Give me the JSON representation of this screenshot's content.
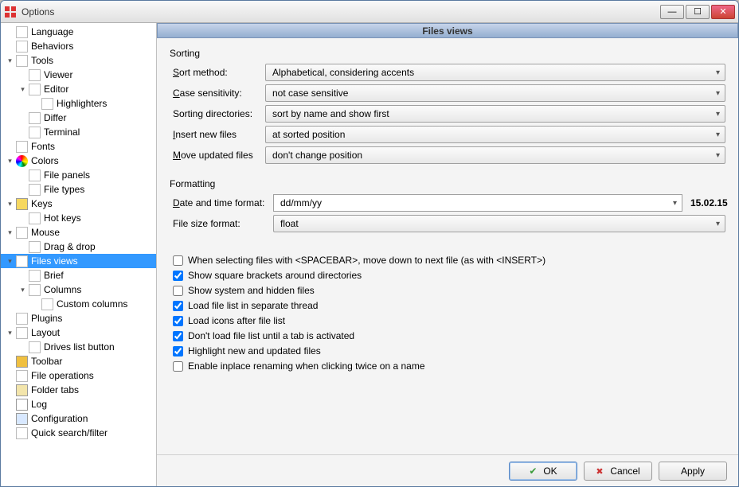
{
  "window": {
    "title": "Options"
  },
  "tree": [
    {
      "level": 0,
      "label": "Language",
      "icon": "page"
    },
    {
      "level": 0,
      "label": "Behaviors",
      "icon": "page"
    },
    {
      "level": 0,
      "label": "Tools",
      "icon": "page",
      "expander": "▾"
    },
    {
      "level": 1,
      "label": "Viewer",
      "icon": "page"
    },
    {
      "level": 1,
      "label": "Editor",
      "icon": "page",
      "expander": "▾"
    },
    {
      "level": 2,
      "label": "Highlighters",
      "icon": "page"
    },
    {
      "level": 1,
      "label": "Differ",
      "icon": "page"
    },
    {
      "level": 1,
      "label": "Terminal",
      "icon": "page"
    },
    {
      "level": 0,
      "label": "Fonts",
      "icon": "page"
    },
    {
      "level": 0,
      "label": "Colors",
      "icon": "colorball",
      "expander": "▾"
    },
    {
      "level": 1,
      "label": "File panels",
      "icon": "page"
    },
    {
      "level": 1,
      "label": "File types",
      "icon": "page"
    },
    {
      "level": 0,
      "label": "Keys",
      "icon": "key",
      "expander": "▾"
    },
    {
      "level": 1,
      "label": "Hot keys",
      "icon": "page"
    },
    {
      "level": 0,
      "label": "Mouse",
      "icon": "page",
      "expander": "▾"
    },
    {
      "level": 1,
      "label": "Drag & drop",
      "icon": "page"
    },
    {
      "level": 0,
      "label": "Files views",
      "icon": "page",
      "expander": "▾",
      "selected": true
    },
    {
      "level": 1,
      "label": "Brief",
      "icon": "page"
    },
    {
      "level": 1,
      "label": "Columns",
      "icon": "page",
      "expander": "▾"
    },
    {
      "level": 2,
      "label": "Custom columns",
      "icon": "page"
    },
    {
      "level": 0,
      "label": "Plugins",
      "icon": "page"
    },
    {
      "level": 0,
      "label": "Layout",
      "icon": "page",
      "expander": "▾"
    },
    {
      "level": 1,
      "label": "Drives list button",
      "icon": "page"
    },
    {
      "level": 0,
      "label": "Toolbar",
      "icon": "toolbar"
    },
    {
      "level": 0,
      "label": "File operations",
      "icon": "page"
    },
    {
      "level": 0,
      "label": "Folder tabs",
      "icon": "folder"
    },
    {
      "level": 0,
      "label": "Log",
      "icon": "log"
    },
    {
      "level": 0,
      "label": "Configuration",
      "icon": "config"
    },
    {
      "level": 0,
      "label": "Quick search/filter",
      "icon": "page"
    }
  ],
  "panel": {
    "title": "Files views",
    "sorting_group": "Sorting",
    "formatting_group": "Formatting",
    "labels": {
      "sort_method": "Sort method:",
      "case_sensitivity": "Case sensitivity:",
      "sorting_directories": "Sorting directories:",
      "insert_new_files": "Insert new files",
      "move_updated_files": "Move updated files",
      "date_format": "Date and time format:",
      "file_size_format": "File size format:"
    },
    "values": {
      "sort_method": "Alphabetical, considering accents",
      "case_sensitivity": "not case sensitive",
      "sorting_directories": "sort by name and show first",
      "insert_new_files": "at sorted position",
      "move_updated_files": "don't change position",
      "date_format": "dd/mm/yy",
      "date_preview": "15.02.15",
      "file_size_format": "float"
    },
    "checks": [
      {
        "label": "When selecting files with <SPACEBAR>, move down to next file (as with <INSERT>)",
        "checked": false
      },
      {
        "label": "Show square brackets around directories",
        "checked": true
      },
      {
        "label": "Show system and hidden files",
        "checked": false
      },
      {
        "label": "Load file list in separate thread",
        "checked": true
      },
      {
        "label": "Load icons after file list",
        "checked": true
      },
      {
        "label": "Don't load file list until a tab is activated",
        "checked": true
      },
      {
        "label": "Highlight new and updated files",
        "checked": true
      },
      {
        "label": "Enable inplace renaming when clicking twice on a name",
        "checked": false
      }
    ]
  },
  "footer": {
    "ok": "OK",
    "cancel": "Cancel",
    "apply": "Apply"
  }
}
